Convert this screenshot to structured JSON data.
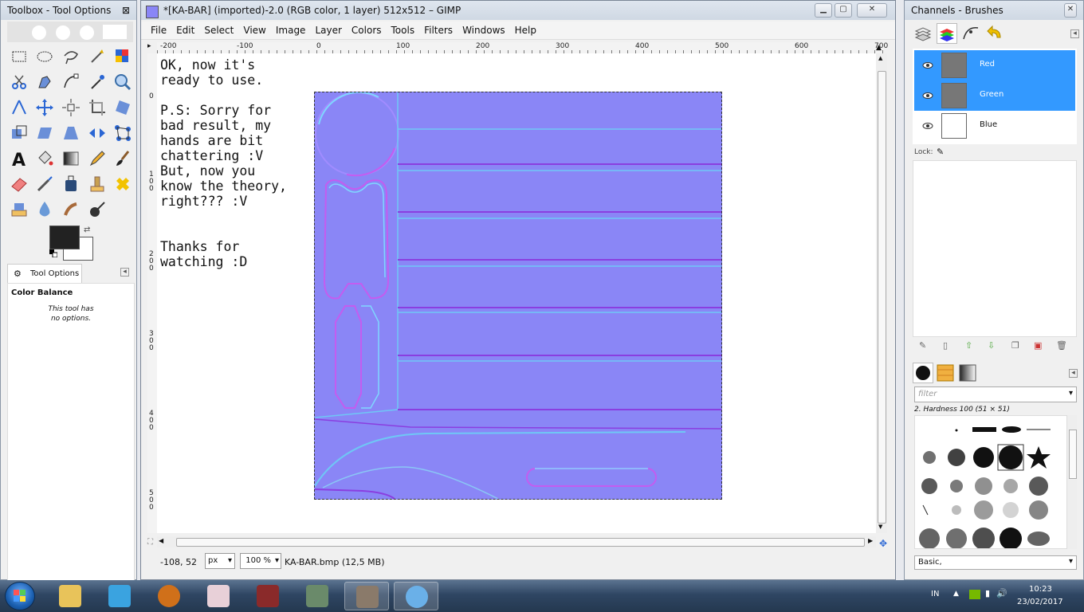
{
  "toolbox": {
    "title": "Toolbox - Tool Options",
    "close": "⊠",
    "tool_options_tab": "Tool Options",
    "tool_name": "Color Balance",
    "no_options_text": "This tool has no options."
  },
  "gimp_window": {
    "title": "*[KA-BAR] (imported)-2.0 (RGB color, 1 layer) 512x512 – GIMP",
    "menu": [
      "File",
      "Edit",
      "Select",
      "View",
      "Image",
      "Layer",
      "Colors",
      "Tools",
      "Filters",
      "Windows",
      "Help"
    ],
    "ruler_h": [
      "-200",
      "-100",
      "0",
      "100",
      "200",
      "300",
      "400",
      "500",
      "600",
      "700"
    ],
    "ruler_v": [
      "0",
      "100",
      "200",
      "300",
      "400",
      "500"
    ],
    "canvas_note": "OK, now it's\nready to use.\n\nP.S: Sorry for\nbad result, my\nhands are bit\nchattering :V\nBut, now you\nknow the theory,\nright??? :V\n\n\nThanks for\nwatching :D",
    "pointer_coords": "-108, 52",
    "unit": "px",
    "zoom": "100 %",
    "file_info": "KA-BAR.bmp (12,5 MB)"
  },
  "dock": {
    "title": "Channels - Brushes",
    "channels": [
      {
        "name": "Red",
        "selected": true
      },
      {
        "name": "Green",
        "selected": true
      },
      {
        "name": "Blue",
        "selected": false
      }
    ],
    "lock_label": "Lock:",
    "filter_placeholder": "filter",
    "brush_name": "2. Hardness 100 (51 × 51)",
    "preset": "Basic,"
  },
  "taskbar": {
    "language": "IN",
    "time": "10:23",
    "date": "23/02/2017"
  },
  "colors": {
    "normal_map": "#8a86f6",
    "selection": "#3399ff"
  }
}
